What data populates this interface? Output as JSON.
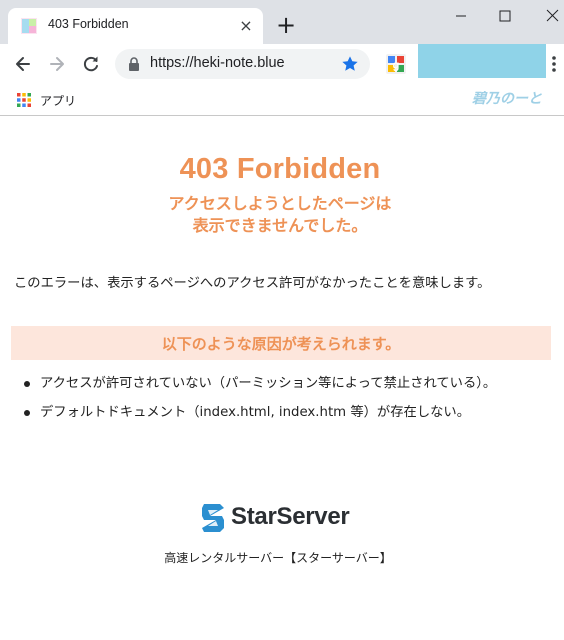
{
  "browser": {
    "tab_title": "403 Forbidden",
    "tab_close": "×",
    "new_tab": "+",
    "url": "https://heki-note.blue",
    "bookmarks": {
      "apps_label": "アプリ",
      "brand_label": "碧乃のーと"
    },
    "colors": {
      "tabstrip": "#dee1e6",
      "star": "#1a73e8",
      "profile_block": "#8fd3e8"
    }
  },
  "page": {
    "title": "403 Forbidden",
    "subtitle_line1": "アクセスしようとしたページは",
    "subtitle_line2": "表示できませんでした。",
    "description": "このエラーは、表示するページへのアクセス許可がなかったことを意味します。",
    "reasons_heading": "以下のような原因が考えられます。",
    "reasons": [
      "アクセスが許可されていない（パーミッション等によって禁止されている）。",
      "デフォルトドキュメント（index.html, index.htm 等）が存在しない。"
    ],
    "logo_text": "StarServer",
    "footer": "高速レンタルサーバー【スターサーバー】",
    "colors": {
      "accent": "#ee9256",
      "reason_bg": "#fde6dc",
      "logo_mark": "#2b8fd0"
    }
  }
}
